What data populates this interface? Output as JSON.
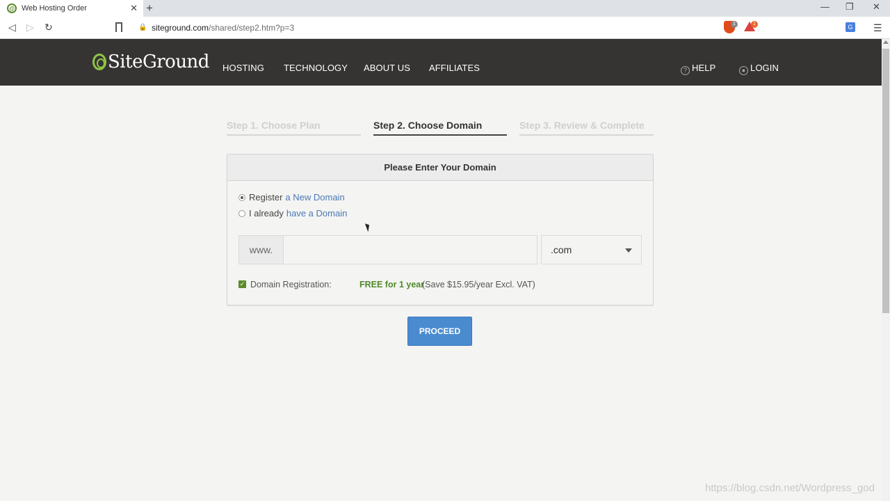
{
  "browser": {
    "tab_title": "Web Hosting Order",
    "url_host": "siteground.com",
    "url_path": "/shared/step2.htm?p=3",
    "brave_badge": "1",
    "rewards_badge": "1"
  },
  "header": {
    "logo_text": "SiteGround",
    "nav": [
      "HOSTING",
      "TECHNOLOGY",
      "ABOUT US",
      "AFFILIATES"
    ],
    "help": "HELP",
    "login": "LOGIN"
  },
  "steps": [
    {
      "label": "Step 1. Choose Plan",
      "state": "done"
    },
    {
      "label": "Step 2. Choose Domain",
      "state": "active"
    },
    {
      "label": "Step 3. Review & Complete",
      "state": "pending"
    }
  ],
  "panel": {
    "title": "Please Enter Your Domain",
    "option1_prefix": "Register",
    "option1_link": "a New Domain",
    "option2_prefix": "I already",
    "option2_link": "have a Domain",
    "www": "www.",
    "domain_value": "",
    "tld": ".com",
    "reg_label": "Domain Registration:",
    "reg_free": "FREE for 1 year",
    "reg_save": "(Save $15.95/year Excl. VAT)"
  },
  "proceed": "PROCEED",
  "watermark": "https://blog.csdn.net/Wordpress_god",
  "colors": {
    "header_bg": "#363432",
    "accent_green": "#8fc547",
    "button_blue": "#4a8bd0"
  }
}
